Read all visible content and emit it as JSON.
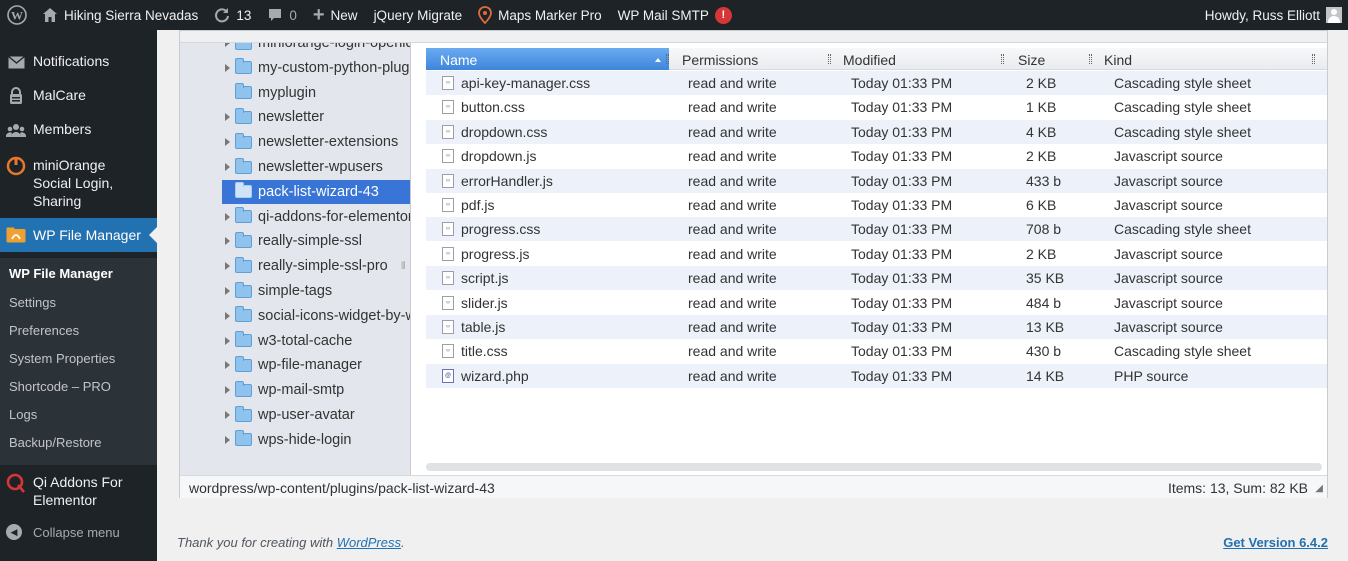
{
  "admin_bar": {
    "site_name": "Hiking Sierra Nevadas",
    "updates_count": "13",
    "comments_count": "0",
    "new_label": "New",
    "jquery_migrate": "jQuery Migrate",
    "maps_marker": "Maps Marker Pro",
    "wp_mail_smtp": "WP Mail SMTP",
    "smtp_badge": "!",
    "howdy": "Howdy, Russ Elliott"
  },
  "sidebar": {
    "notifications": "Notifications",
    "malcare": "MalCare",
    "members": "Members",
    "miniorange": "miniOrange Social Login, Sharing",
    "wp_file_manager": "WP File Manager",
    "submenu": [
      "WP File Manager",
      "Settings",
      "Preferences",
      "System Properties",
      "Shortcode – PRO",
      "Logs",
      "Backup/Restore"
    ],
    "qi_addons": "Qi Addons For Elementor",
    "collapse": "Collapse menu"
  },
  "tree": {
    "items": [
      {
        "label": "miniorange-login-openid",
        "arrow": true
      },
      {
        "label": "my-custom-python-plugin",
        "arrow": true
      },
      {
        "label": "myplugin",
        "arrow": false
      },
      {
        "label": "newsletter",
        "arrow": true
      },
      {
        "label": "newsletter-extensions",
        "arrow": true
      },
      {
        "label": "newsletter-wpusers",
        "arrow": true
      },
      {
        "label": "pack-list-wizard-43",
        "arrow": false,
        "selected": true
      },
      {
        "label": "qi-addons-for-elementor",
        "arrow": true
      },
      {
        "label": "really-simple-ssl",
        "arrow": true
      },
      {
        "label": "really-simple-ssl-pro",
        "arrow": true
      },
      {
        "label": "simple-tags",
        "arrow": true
      },
      {
        "label": "social-icons-widget-by-wpzoom",
        "arrow": true
      },
      {
        "label": "w3-total-cache",
        "arrow": true
      },
      {
        "label": "wp-file-manager",
        "arrow": true
      },
      {
        "label": "wp-mail-smtp",
        "arrow": true
      },
      {
        "label": "wp-user-avatar",
        "arrow": true
      },
      {
        "label": "wps-hide-login",
        "arrow": true
      }
    ]
  },
  "list": {
    "columns": {
      "name": "Name",
      "permissions": "Permissions",
      "modified": "Modified",
      "size": "Size",
      "kind": "Kind"
    },
    "files": [
      {
        "name": "api-key-manager.css",
        "permissions": "read and write",
        "modified": "Today 01:33 PM",
        "size": "2 KB",
        "kind": "Cascading style sheet",
        "icon": "css-file-icon"
      },
      {
        "name": "button.css",
        "permissions": "read and write",
        "modified": "Today 01:33 PM",
        "size": "1 KB",
        "kind": "Cascading style sheet",
        "icon": "css-file-icon"
      },
      {
        "name": "dropdown.css",
        "permissions": "read and write",
        "modified": "Today 01:33 PM",
        "size": "4 KB",
        "kind": "Cascading style sheet",
        "icon": "css-file-icon"
      },
      {
        "name": "dropdown.js",
        "permissions": "read and write",
        "modified": "Today 01:33 PM",
        "size": "2 KB",
        "kind": "Javascript source",
        "icon": "js-file-icon"
      },
      {
        "name": "errorHandler.js",
        "permissions": "read and write",
        "modified": "Today 01:33 PM",
        "size": "433 b",
        "kind": "Javascript source",
        "icon": "js-file-icon"
      },
      {
        "name": "pdf.js",
        "permissions": "read and write",
        "modified": "Today 01:33 PM",
        "size": "6 KB",
        "kind": "Javascript source",
        "icon": "js-file-icon"
      },
      {
        "name": "progress.css",
        "permissions": "read and write",
        "modified": "Today 01:33 PM",
        "size": "708 b",
        "kind": "Cascading style sheet",
        "icon": "css-file-icon"
      },
      {
        "name": "progress.js",
        "permissions": "read and write",
        "modified": "Today 01:33 PM",
        "size": "2 KB",
        "kind": "Javascript source",
        "icon": "js-file-icon"
      },
      {
        "name": "script.js",
        "permissions": "read and write",
        "modified": "Today 01:33 PM",
        "size": "35 KB",
        "kind": "Javascript source",
        "icon": "js-file-icon"
      },
      {
        "name": "slider.js",
        "permissions": "read and write",
        "modified": "Today 01:33 PM",
        "size": "484 b",
        "kind": "Javascript source",
        "icon": "js-file-icon"
      },
      {
        "name": "table.js",
        "permissions": "read and write",
        "modified": "Today 01:33 PM",
        "size": "13 KB",
        "kind": "Javascript source",
        "icon": "js-file-icon"
      },
      {
        "name": "title.css",
        "permissions": "read and write",
        "modified": "Today 01:33 PM",
        "size": "430 b",
        "kind": "Cascading style sheet",
        "icon": "css-file-icon"
      },
      {
        "name": "wizard.php",
        "permissions": "read and write",
        "modified": "Today 01:33 PM",
        "size": "14 KB",
        "kind": "PHP source",
        "icon": "php-file-icon"
      }
    ]
  },
  "status": {
    "path": "wordpress/wp-content/plugins/pack-list-wizard-43",
    "summary": "Items: 13, Sum: 82 KB"
  },
  "footer": {
    "thanks_prefix": "Thank you for creating with",
    "wordpress_link": "WordPress",
    "thanks_suffix": ".",
    "version": "Get Version 6.4.2"
  },
  "colors": {
    "admin_bar_bg": "#1d2327",
    "accent": "#2271b1",
    "selected_folder": "#3875d7",
    "alert": "#d63638"
  }
}
